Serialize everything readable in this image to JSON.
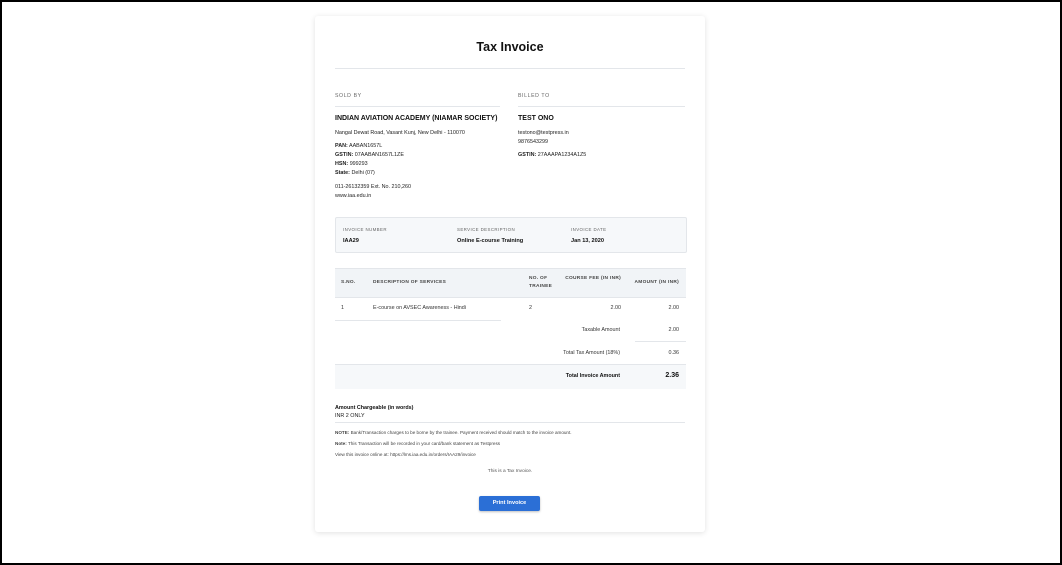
{
  "title": "Tax Invoice",
  "sold_by": {
    "heading": "SOLD BY",
    "name": "INDIAN AVIATION ACADEMY (NIAMAR SOCIETY)",
    "address": "Nangal Dewat Road, Vasant Kunj, New Delhi - 110070",
    "pan_label": "PAN:",
    "pan": "AABAN1657L",
    "gstin_label": "GSTIN:",
    "gstin": "07AABAN1657L1ZE",
    "hsn_label": "HSN:",
    "hsn": "999293",
    "state_label": "State:",
    "state": "Delhi (07)",
    "phone": "011-26132359 Ext. No. 210,260",
    "website": "www.iaa.edu.in"
  },
  "billed_to": {
    "heading": "BILLED TO",
    "name": "TEST ONO",
    "email": "testono@testpress.in",
    "phone": "9876543299",
    "gstin_label": "GSTIN:",
    "gstin": "27AAAPA1234A1Z5"
  },
  "meta": {
    "invoice_number_label": "INVOICE NUMBER",
    "invoice_number": "IAA29",
    "service_label": "SERVICE DESCRIPTION",
    "service": "Online E-course Training",
    "date_label": "INVOICE DATE",
    "date": "Jan 13, 2020"
  },
  "table": {
    "headers": {
      "sno": "S.NO.",
      "desc": "DESCRIPTION OF SERVICES",
      "trainee": "NO. OF TRAINEE",
      "fee": "COURSE FEE (IN INR)",
      "amount": "AMOUNT (IN INR)"
    },
    "row": {
      "sno": "1",
      "desc": "E-course on AVSEC Awareness - Hindi",
      "trainee": "2",
      "fee": "2.00",
      "amount": "2.00"
    },
    "taxable_label": "Taxable Amount",
    "taxable_value": "2.00",
    "tax_label": "Total Tax Amount (18%)",
    "tax_value": "0.36",
    "total_label": "Total Invoice Amount",
    "total_value": "2.36"
  },
  "words": {
    "label": "Amount Chargeable (in words)",
    "value": "INR 2 ONLY"
  },
  "notes": {
    "note1_label": "NOTE:",
    "note1": "Bank/Transaction charges to be borne by the trainee. Payment received should match to the invoice amount.",
    "note2_label": "Note:",
    "note2": "This Transaction will be recorded in your card/bank statement as Testpress",
    "note3": "View this invoice online at: https://lms.iaa.edu.in/orders/IAA29/invoice"
  },
  "footer_text": "This is a Tax Invoice.",
  "print_button": "Print Invoice",
  "colors": {
    "accent": "#2b6fd6",
    "card_bg": "#ffffff",
    "table_header": "#f1f4f7"
  }
}
